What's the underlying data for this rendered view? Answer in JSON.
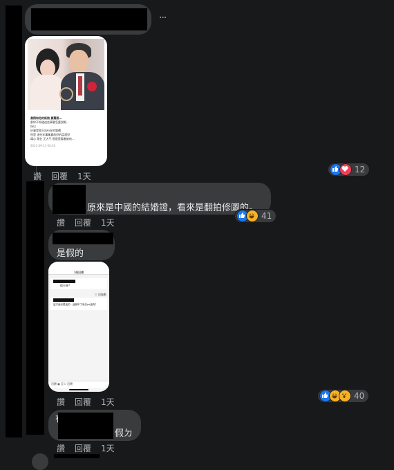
{
  "comment1": {
    "more_label": "···",
    "actions": {
      "like": "讚",
      "reply": "回覆",
      "time": "1天"
    },
    "reaction_count": "12",
    "reaction_icons": [
      "like-icon",
      "love-icon"
    ],
    "photo": {
      "lines": [
        "費翔和他的新娘 費翼翔...",
        "那你不知道這些事要怎麼說呢...",
        "所以",
        "好事是我王出行好的樂禮",
        "但是 這些年事業真的好的話就好",
        "痛心 我在 正大气 那是是看着她的..."
      ],
      "footer": "2021-09-13 06:46"
    }
  },
  "reply1": {
    "text": "原來是中國的結婚證，看來是翻拍修圖的。",
    "actions": {
      "like": "讚",
      "reply": "回覆",
      "time": "1天"
    },
    "reaction_count": "41",
    "reaction_icons": [
      "like-icon",
      "haha-icon"
    ]
  },
  "reply2": {
    "text": "是假的",
    "actions": {
      "like": "讚",
      "reply": "回覆",
      "time": "1天"
    },
    "reaction_count": "40",
    "reaction_icons": [
      "like-icon",
      "haha-icon",
      "wow-icon"
    ],
    "screenshot": {
      "header": "1條回覆",
      "line1": "假分享?",
      "line2": "這方面也是這的…這個年了我去po還有？",
      "side": "三 回復數",
      "footer": "回覆 ● 至少 回覆"
    }
  },
  "reply3": {
    "text_prefix": "有",
    "text_suffix": "假ㄉ",
    "actions": {
      "like": "讚",
      "reply": "回覆",
      "time": "1天"
    }
  },
  "colors": {
    "background": "#18191a",
    "bubble": "#3a3b3c",
    "like": "#1877f2",
    "love": "#f33e58",
    "haha": "#f7b125"
  }
}
